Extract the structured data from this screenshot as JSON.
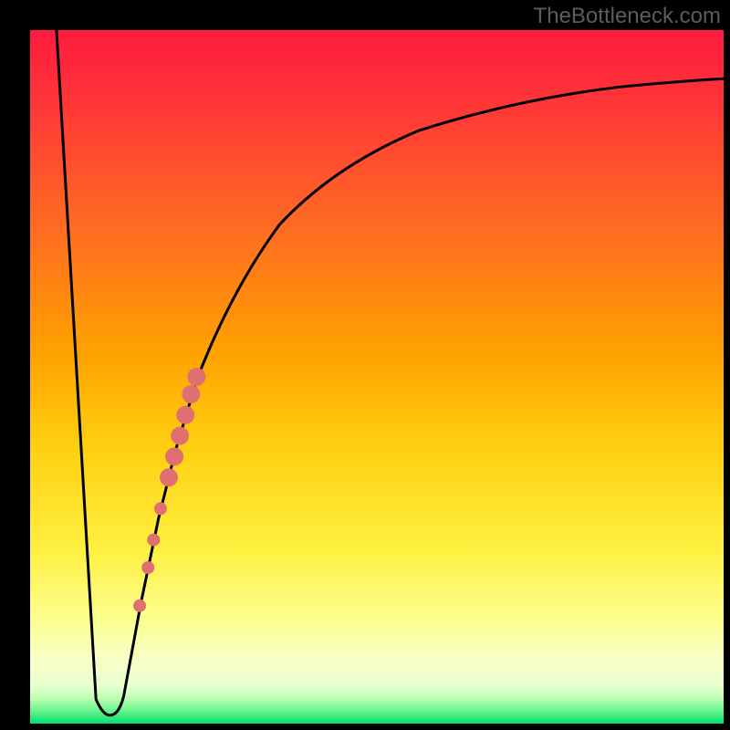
{
  "watermark": "TheBottleneck.com",
  "chart_data": {
    "type": "line",
    "title": "",
    "xlabel": "",
    "ylabel": "",
    "xlim": [
      0,
      1
    ],
    "ylim": [
      0,
      1
    ],
    "grid": false,
    "legend": false,
    "background_gradient": {
      "top_color": "#ff1040",
      "mid_color": "#ffb000",
      "yellow_color": "#fff040",
      "pale_color": "#faffc0",
      "bottom_color": "#00e070"
    },
    "curve": {
      "description": "Sharp V-shaped dip near x≈0.11 reaching y≈0 (bottleneck minimum), steep rise back up asymptotically approaching y≈0.92 toward x=1.",
      "x": [
        0.033,
        0.09,
        0.105,
        0.12,
        0.135,
        0.16,
        0.18,
        0.2,
        0.22,
        0.25,
        0.28,
        0.32,
        0.38,
        0.45,
        0.55,
        0.7,
        0.85,
        1.0
      ],
      "y": [
        1.0,
        0.06,
        0.02,
        0.02,
        0.06,
        0.18,
        0.27,
        0.35,
        0.42,
        0.5,
        0.57,
        0.64,
        0.72,
        0.78,
        0.83,
        0.87,
        0.9,
        0.92
      ]
    },
    "markers": {
      "description": "Salmon-colored circular data points clustered on the rising right arm near the bottom of the dip.",
      "color": "#e07070",
      "points": [
        {
          "x": 0.158,
          "y": 0.17,
          "r": 7
        },
        {
          "x": 0.17,
          "y": 0.225,
          "r": 7
        },
        {
          "x": 0.178,
          "y": 0.265,
          "r": 7
        },
        {
          "x": 0.188,
          "y": 0.31,
          "r": 7
        },
        {
          "x": 0.2,
          "y": 0.355,
          "r": 10
        },
        {
          "x": 0.208,
          "y": 0.385,
          "r": 10
        },
        {
          "x": 0.216,
          "y": 0.415,
          "r": 10
        },
        {
          "x": 0.224,
          "y": 0.445,
          "r": 10
        },
        {
          "x": 0.232,
          "y": 0.475,
          "r": 10
        },
        {
          "x": 0.24,
          "y": 0.5,
          "r": 10
        }
      ]
    }
  }
}
